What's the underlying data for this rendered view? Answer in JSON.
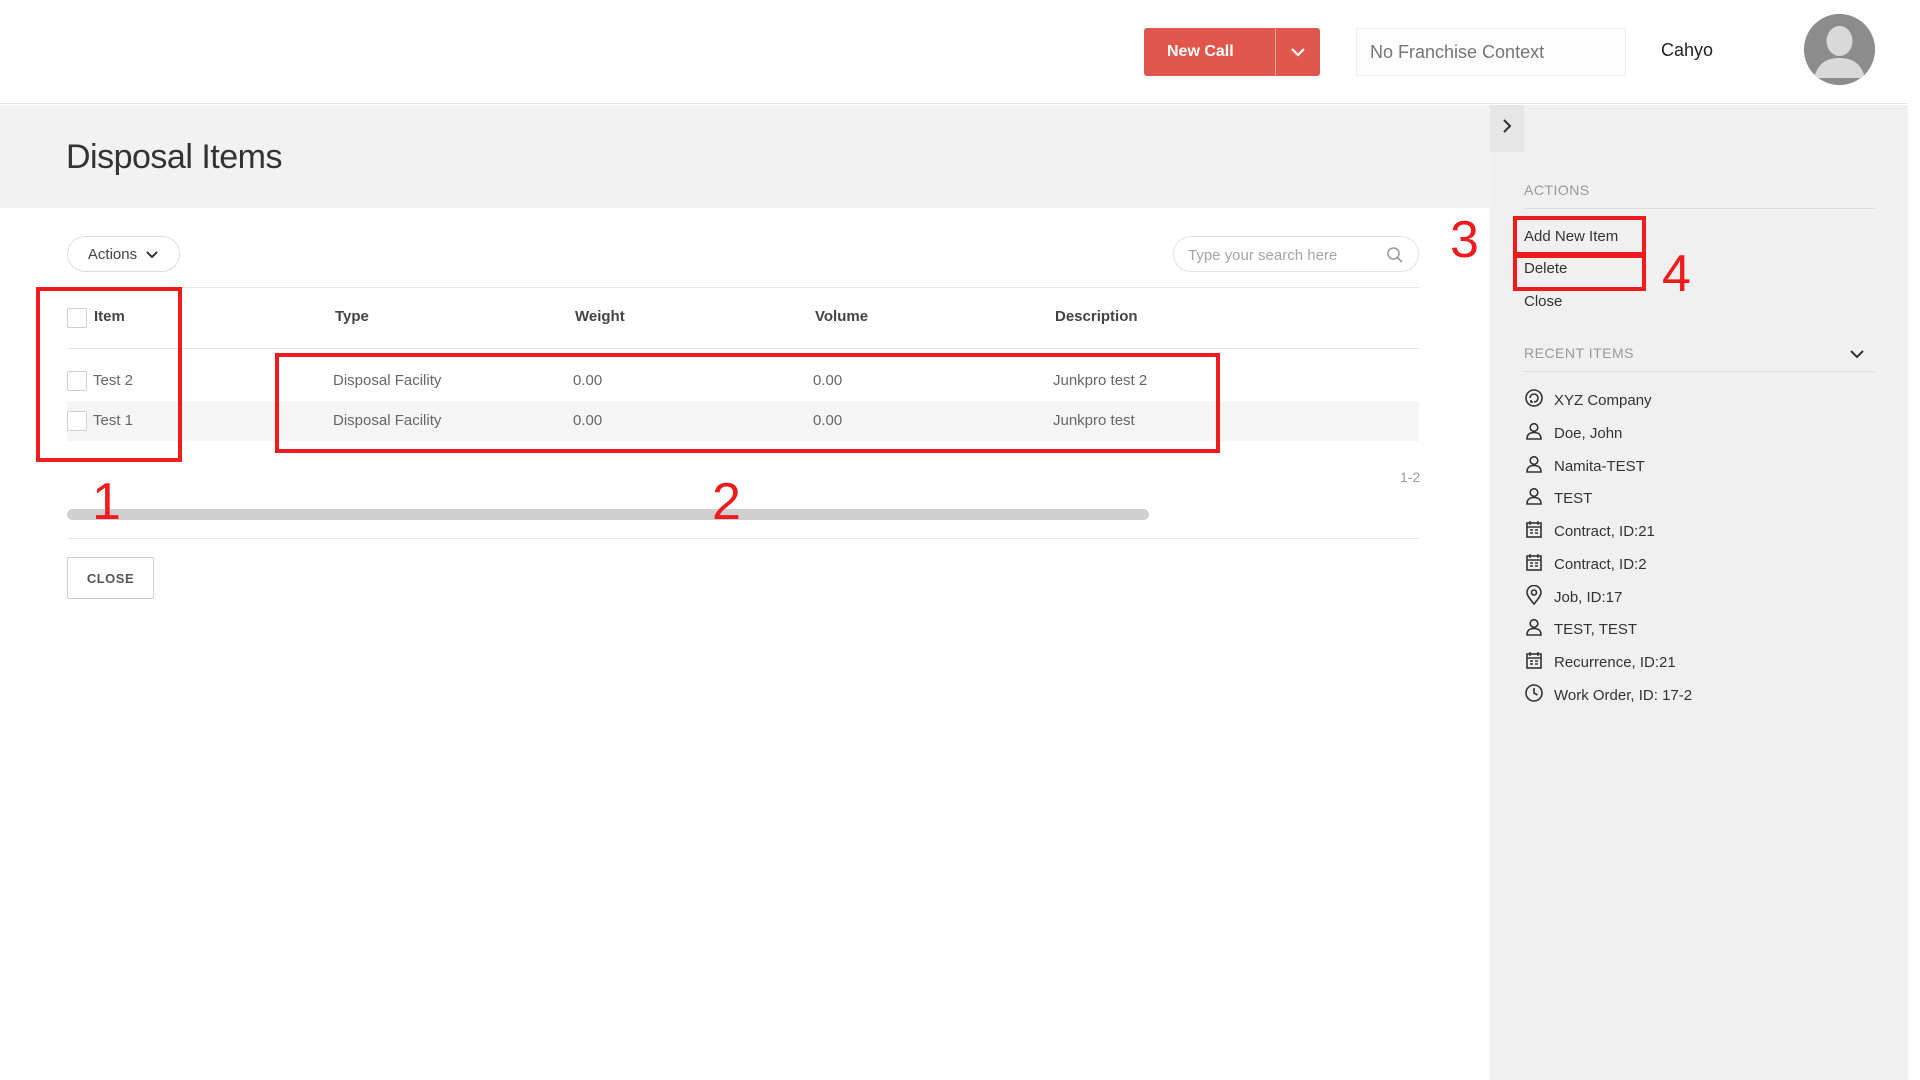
{
  "header": {
    "new_call_label": "New Call",
    "franchise_placeholder": "No Franchise Context",
    "username": "Cahyo"
  },
  "page": {
    "title": "Disposal Items",
    "actions_label": "Actions",
    "search_placeholder": "Type your search here",
    "close_label": "CLOSE",
    "pager_text": "1-2"
  },
  "table": {
    "columns": [
      "Item",
      "Type",
      "Weight",
      "Volume",
      "Description"
    ],
    "rows": [
      {
        "item": "Test 2",
        "type": "Disposal Facility",
        "weight": "0.00",
        "volume": "0.00",
        "description": "Junkpro test 2"
      },
      {
        "item": "Test 1",
        "type": "Disposal Facility",
        "weight": "0.00",
        "volume": "0.00",
        "description": "Junkpro test"
      }
    ]
  },
  "sidebar": {
    "actions_title": "ACTIONS",
    "actions": [
      "Add New Item",
      "Delete",
      "Close"
    ],
    "recent_title": "RECENT ITEMS",
    "recent": [
      {
        "label": "XYZ Company",
        "icon": "company-icon"
      },
      {
        "label": "Doe, John",
        "icon": "person-icon"
      },
      {
        "label": "Namita-TEST",
        "icon": "person-icon"
      },
      {
        "label": "TEST",
        "icon": "person-icon"
      },
      {
        "label": "Contract, ID:21",
        "icon": "contract-icon"
      },
      {
        "label": "Contract, ID:2",
        "icon": "contract-icon"
      },
      {
        "label": "Job, ID:17",
        "icon": "location-pin-icon"
      },
      {
        "label": "TEST, TEST",
        "icon": "person-icon"
      },
      {
        "label": "Recurrence, ID:21",
        "icon": "calendar-icon"
      },
      {
        "label": "Work Order, ID: 17-2",
        "icon": "clock-icon"
      }
    ]
  },
  "annotations": [
    "1",
    "2",
    "3",
    "4"
  ],
  "colors": {
    "accent": "#e2574c",
    "annotation": "#ee1c1c",
    "panel_bg": "#f0f0f0",
    "header_bg": "#f2f2f2"
  }
}
